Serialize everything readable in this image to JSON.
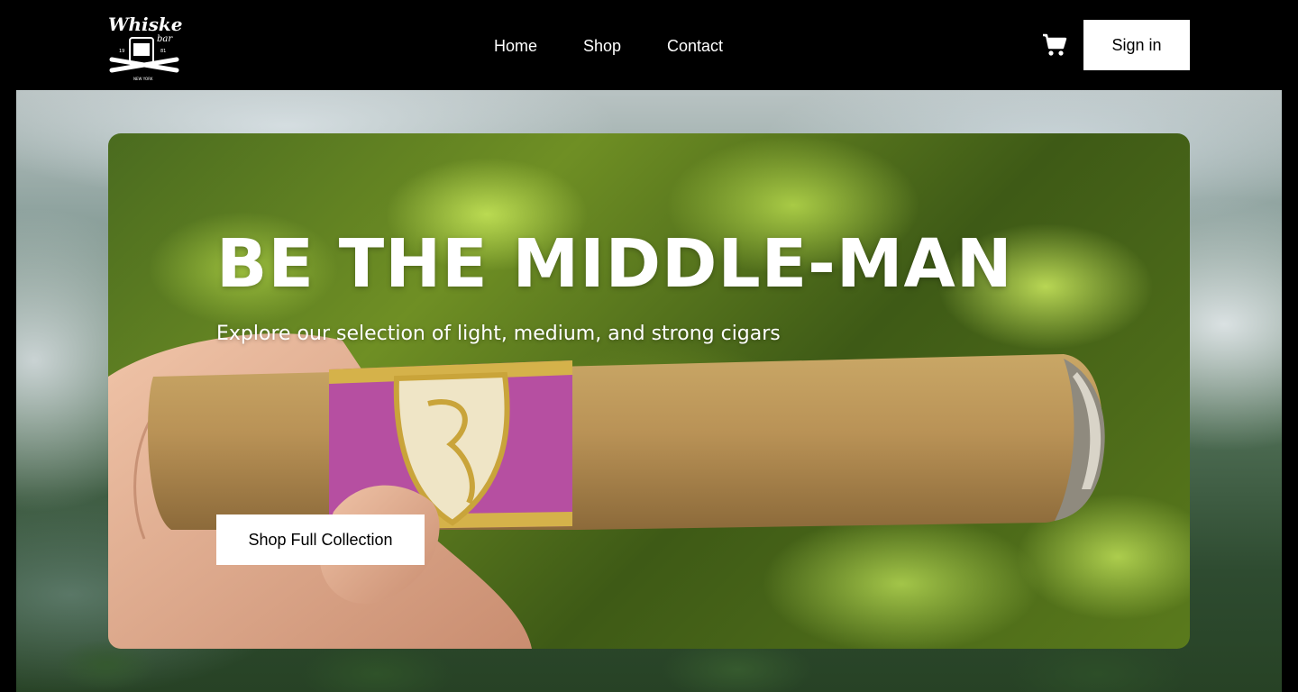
{
  "header": {
    "logo": {
      "name": "whiskey-bar-logo",
      "text_line1": "Whiskey",
      "text_line2": "bar",
      "text_year_left": "19",
      "text_year_right": "81",
      "text_city": "NEW YORK"
    },
    "nav": {
      "home": "Home",
      "shop": "Shop",
      "contact": "Contact"
    },
    "cart_icon": "shopping-cart-icon",
    "signin_label": "Sign in"
  },
  "hero": {
    "title": "BE THE MIDDLE-MAN",
    "subtitle": "Explore our selection of light, medium, and strong cigars",
    "cta_label": "Shop Full Collection"
  },
  "colors": {
    "header_bg": "#000000",
    "button_bg": "#ffffff",
    "button_text": "#000000",
    "hero_text": "#ffffff"
  }
}
